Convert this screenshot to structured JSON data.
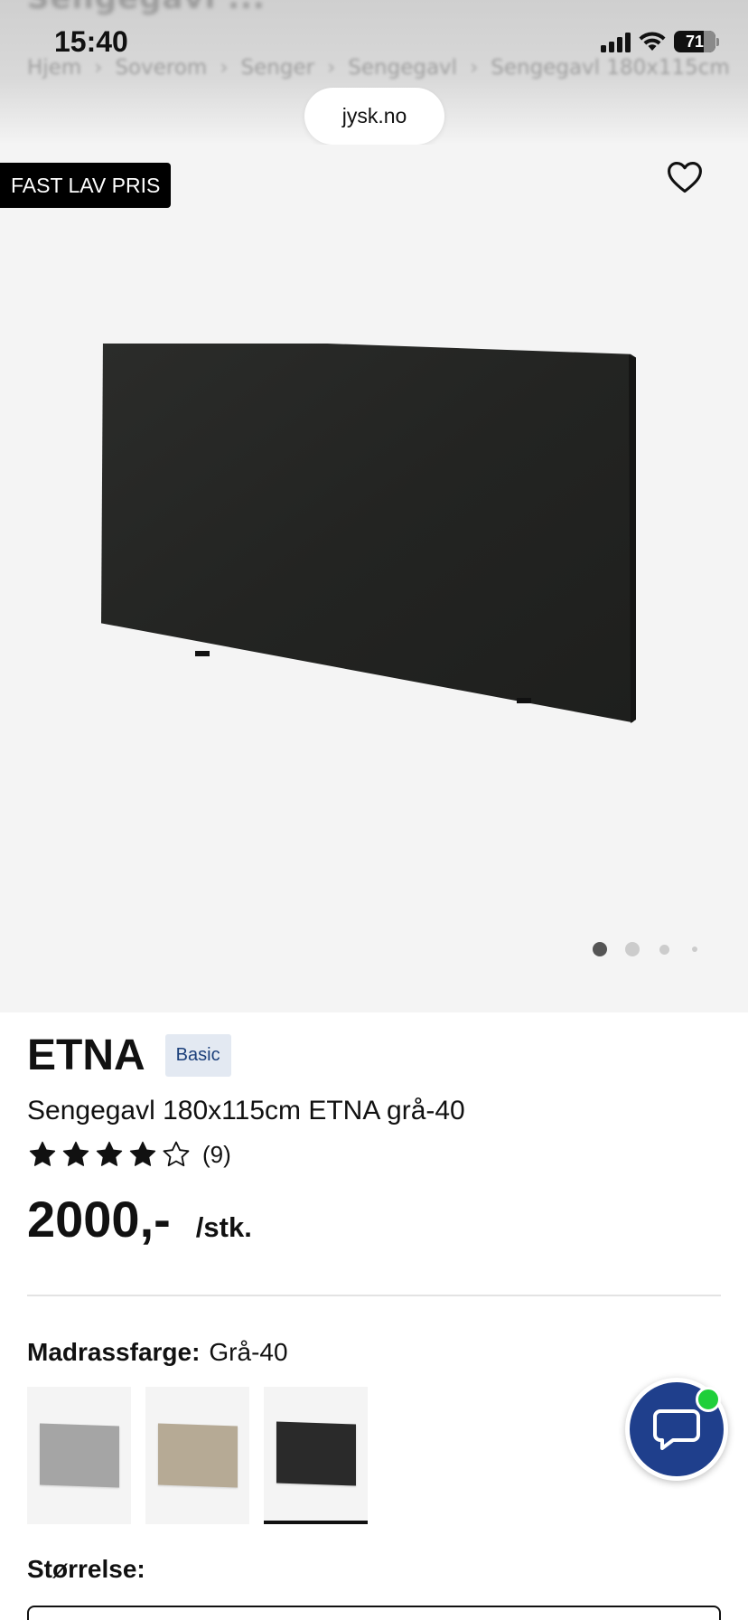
{
  "status_bar": {
    "time": "15:40",
    "battery_text": "71",
    "battery_level_percent": 71
  },
  "browser": {
    "url_pill": "jysk.no",
    "blurred_title": "Sengegavl ...",
    "breadcrumb": [
      "Hjem",
      "Soverom",
      "Senger",
      "Sengegavl",
      "Sengegavl 180x115cm"
    ],
    "breadcrumb_separator": "›"
  },
  "gallery": {
    "badge": "FAST LAV PRIS",
    "favorite_icon": "heart-outline-icon",
    "image_count": 4,
    "active_index": 0
  },
  "product": {
    "brand": "ETNA",
    "tag": "Basic",
    "description": "Sengegavl 180x115cm ETNA grå-40",
    "rating": 4,
    "rating_max": 5,
    "review_count": "(9)",
    "price": "2000,-",
    "unit": "/stk."
  },
  "options": {
    "color_label": "Madrassfarge:",
    "color_value": "Grå-40",
    "swatches": [
      {
        "name": "light-grey",
        "color": "#a5a5a5",
        "selected": false
      },
      {
        "name": "beige",
        "color": "#b6aa95",
        "selected": false
      },
      {
        "name": "dark-grey",
        "color": "#2a2a2a",
        "selected": true
      }
    ],
    "size_label": "Størrelse:"
  },
  "chat": {
    "icon": "chat-bubble-icon",
    "brand_color": "#1f3f8c",
    "online_color": "#1fcf3a"
  }
}
